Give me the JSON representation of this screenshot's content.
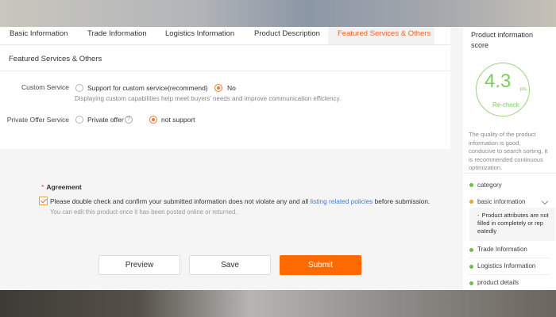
{
  "tabs": [
    {
      "label": "Basic Information",
      "active": false
    },
    {
      "label": "Trade Information",
      "active": false
    },
    {
      "label": "Logistics Information",
      "active": false
    },
    {
      "label": "Product Description",
      "active": false
    },
    {
      "label": "Featured Services & Others",
      "active": true
    }
  ],
  "section": {
    "title": "Featured Services & Others"
  },
  "custom_service": {
    "label": "Custom Service",
    "options": [
      {
        "label": "Support for custom service(recommend)",
        "selected": false
      },
      {
        "label": "No",
        "selected": true
      }
    ],
    "hint": "Displaying custom capabilities help meet buyers' needs and improve communication efficiency."
  },
  "private_offer": {
    "label": "Private Offer Service",
    "options": [
      {
        "label": "Private offer",
        "selected": false
      },
      {
        "label": "not support",
        "selected": true
      }
    ],
    "help_icon": "?"
  },
  "agreement": {
    "required_mark": "*",
    "title": "Agreement",
    "checked": true,
    "text_before": "Please double check and confirm your submitted information does not violate any and all ",
    "link_text": "listing related policies",
    "text_after": " before submission.",
    "note": "You can edit this product once it has been posted online or returned."
  },
  "buttons": {
    "preview": "Preview",
    "save": "Save",
    "submit": "Submit"
  },
  "score_panel": {
    "title": "Product information score",
    "score": "4.3",
    "unit": "pts",
    "recheck": "Re-check",
    "description": "The quality of the product information is good, conducive to search sorting, it is recommended continuous optimization.",
    "items": [
      {
        "label": "category",
        "status": "green"
      },
      {
        "label": "basic information",
        "status": "orange"
      },
      {
        "label": "Trade Information",
        "status": "green"
      },
      {
        "label": "Logistics Information",
        "status": "green"
      },
      {
        "label": "product details",
        "status": "green"
      }
    ],
    "basic_info_issue": "Product attributes are not filled in completely or rep eatedly",
    "bullet": "-"
  },
  "colors": {
    "accent": "#ff6a00",
    "active_tab": "#e8652b",
    "score_green": "#7ccc5e",
    "link": "#3d7fd1"
  }
}
